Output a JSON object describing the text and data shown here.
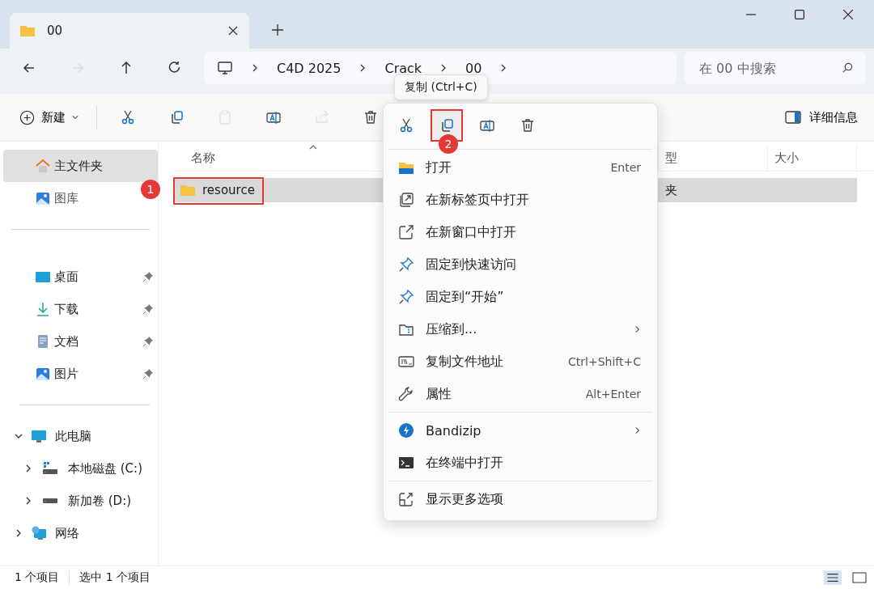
{
  "window": {
    "tab_title": "00"
  },
  "nav": {
    "buttons": [
      {
        "kind": "back",
        "disabled": false
      },
      {
        "kind": "forward",
        "disabled": true
      },
      {
        "kind": "up",
        "disabled": false
      },
      {
        "kind": "refresh",
        "disabled": false
      }
    ],
    "breadcrumb": [
      "C4D 2025",
      "Crack",
      "00"
    ],
    "search": {
      "placeholder": "在 00 中搜索"
    }
  },
  "toolbar": {
    "new_label": "新建",
    "actions": [
      {
        "kind": "cut",
        "disabled": false
      },
      {
        "kind": "copy",
        "disabled": false
      },
      {
        "kind": "paste",
        "disabled": true
      },
      {
        "kind": "rename",
        "disabled": false
      },
      {
        "kind": "share",
        "disabled": true
      },
      {
        "kind": "delete",
        "disabled": false
      }
    ],
    "details_label": "详细信息"
  },
  "tooltip": "复制 (Ctrl+C)",
  "sidebar": {
    "groups": [
      [
        {
          "label": "主文件夹",
          "kind": "home",
          "selected": true,
          "pinned": false
        },
        {
          "label": "图库",
          "kind": "gallery",
          "selected": false,
          "pinned": false
        }
      ],
      [
        {
          "label": "桌面",
          "kind": "desktop",
          "selected": false,
          "pinned": true
        },
        {
          "label": "下载",
          "kind": "download",
          "selected": false,
          "pinned": true
        },
        {
          "label": "文档",
          "kind": "document",
          "selected": false,
          "pinned": true
        },
        {
          "label": "图片",
          "kind": "gallery",
          "selected": false,
          "pinned": true
        }
      ]
    ],
    "tree": [
      {
        "label": "此电脑",
        "kind": "pc",
        "expanded": true,
        "children": [
          {
            "label": "本地磁盘 (C:)",
            "kind": "system-drive",
            "expanded": false
          },
          {
            "label": "新加卷 (D:)",
            "kind": "drive",
            "expanded": false
          }
        ]
      },
      {
        "label": "网络",
        "kind": "network",
        "expanded": false
      }
    ]
  },
  "columns": [
    {
      "label": "名称"
    },
    {
      "label": "型"
    },
    {
      "label": "大小"
    }
  ],
  "rows": [
    {
      "name": "resource",
      "type": "夹",
      "selected": true,
      "marker": "1"
    }
  ],
  "context_menu": {
    "quick_actions": [
      {
        "kind": "cut",
        "selected": false
      },
      {
        "kind": "copy",
        "selected": true,
        "marker": "2"
      },
      {
        "kind": "rename",
        "selected": false
      },
      {
        "kind": "delete",
        "selected": false
      }
    ],
    "sections": [
      [
        {
          "kind": "folder-open",
          "label": "打开",
          "shortcut": "Enter",
          "submenu": false
        },
        {
          "kind": "new-tab",
          "label": "在新标签页中打开",
          "submenu": false
        },
        {
          "kind": "new-window",
          "label": "在新窗口中打开",
          "submenu": false
        },
        {
          "kind": "pin",
          "label": "固定到快速访问",
          "submenu": false
        },
        {
          "kind": "pin",
          "label": "固定到“开始”",
          "submenu": false
        },
        {
          "kind": "zip",
          "label": "压缩到...",
          "submenu": true
        },
        {
          "kind": "path",
          "label": "复制文件地址",
          "shortcut": "Ctrl+Shift+C",
          "submenu": false
        },
        {
          "kind": "wrench",
          "label": "属性",
          "shortcut": "Alt+Enter",
          "submenu": false
        }
      ],
      [
        {
          "kind": "bandizip",
          "label": "Bandizip",
          "submenu": true
        },
        {
          "kind": "terminal",
          "label": "在终端中打开",
          "submenu": false
        }
      ],
      [
        {
          "kind": "more",
          "label": "显示更多选项",
          "submenu": false
        }
      ]
    ]
  },
  "status": [
    "1 个项目",
    "选中 1 个项目"
  ]
}
